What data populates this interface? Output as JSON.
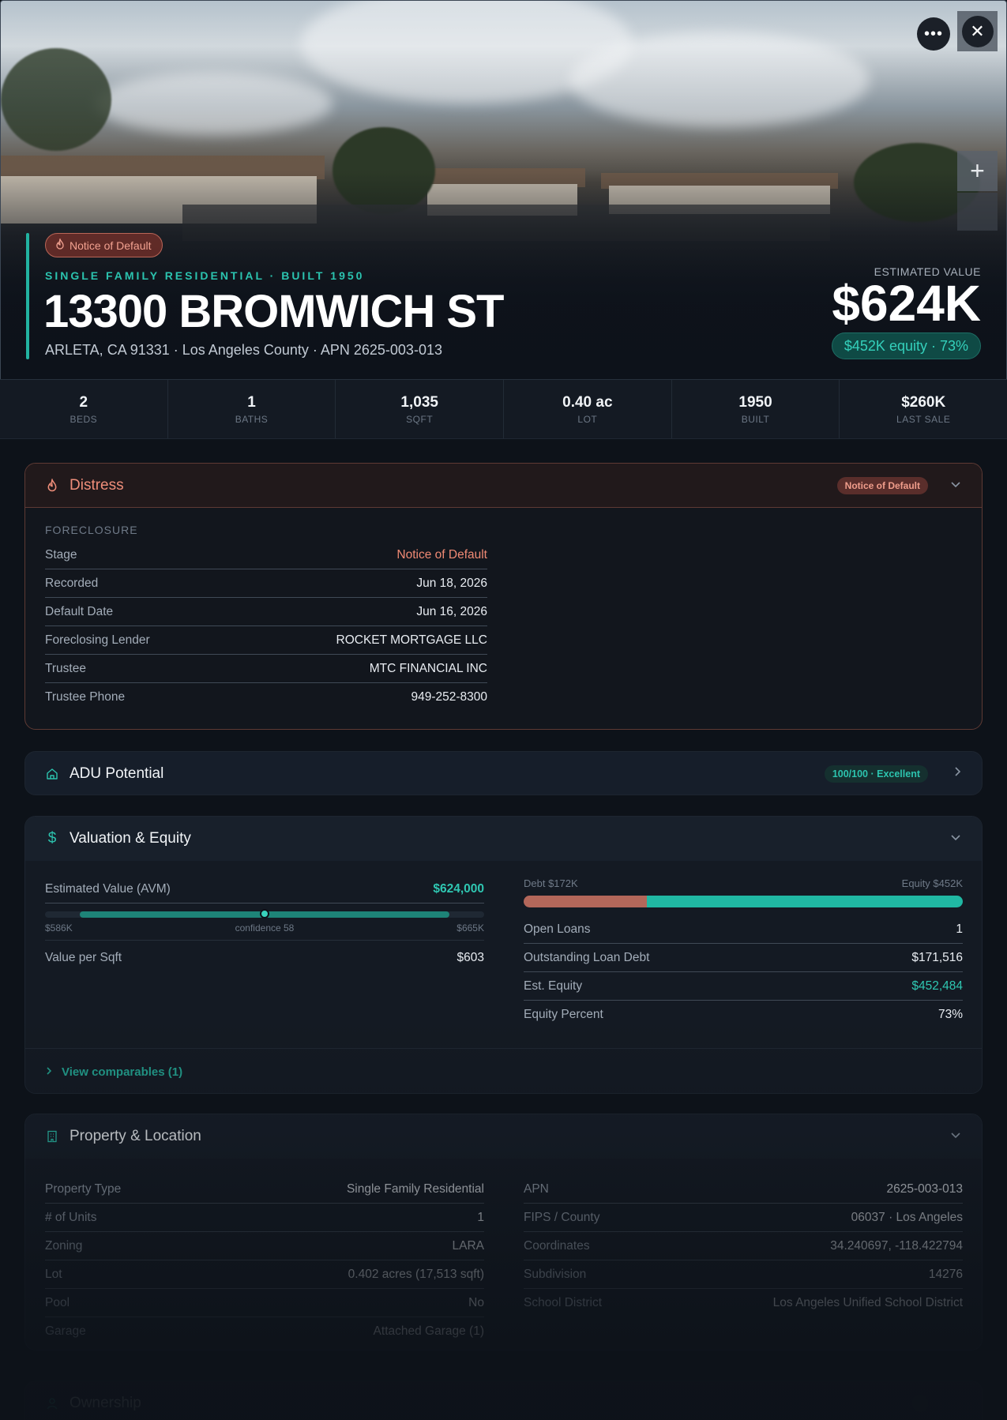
{
  "hero": {
    "distress_badge": "Notice of Default",
    "subtitle": "SINGLE FAMILY RESIDENTIAL · BUILT 1950",
    "title": "13300 BROMWICH ST",
    "address": "ARLETA, CA 91331 · Los Angeles County · APN 2625-003-013",
    "estimated_label": "ESTIMATED VALUE",
    "estimated_value": "$624K",
    "equity_pill": "$452K equity · 73%"
  },
  "stats": [
    {
      "value": "2",
      "label": "BEDS"
    },
    {
      "value": "1",
      "label": "BATHS"
    },
    {
      "value": "1,035",
      "label": "SQFT"
    },
    {
      "value": "0.40 ac",
      "label": "LOT"
    },
    {
      "value": "1950",
      "label": "BUILT"
    },
    {
      "value": "$260K",
      "label": "LAST SALE"
    }
  ],
  "distress": {
    "title": "Distress",
    "badge": "Notice of Default",
    "section": "FORECLOSURE",
    "rows": [
      {
        "k": "Stage",
        "v": "Notice of Default"
      },
      {
        "k": "Recorded",
        "v": "Jun 18, 2026"
      },
      {
        "k": "Default Date",
        "v": "Jun 16, 2026"
      },
      {
        "k": "Foreclosing Lender",
        "v": "ROCKET MORTGAGE LLC"
      },
      {
        "k": "Trustee",
        "v": "MTC FINANCIAL INC"
      },
      {
        "k": "Trustee Phone",
        "v": "949-252-8300"
      }
    ]
  },
  "adu": {
    "title": "ADU Potential",
    "badge": "100/100 · Excellent"
  },
  "valuation": {
    "title": "Valuation & Equity",
    "avm_label": "Estimated Value (AVM)",
    "avm_value": "$624,000",
    "range_low": "$586K",
    "range_high": "$665K",
    "confidence": "confidence 58",
    "avm_position": 0.5,
    "value_per_sqft_label": "Value per Sqft",
    "value_per_sqft": "$603",
    "debt_label": "Debt $172K",
    "equity_label": "Equity $452K",
    "debt_fraction": 0.28,
    "rows": [
      {
        "k": "Open Loans",
        "v": "1"
      },
      {
        "k": "Outstanding Loan Debt",
        "v": "$171,516"
      },
      {
        "k": "Est. Equity",
        "v": "$452,484"
      },
      {
        "k": "Equity Percent",
        "v": "73%"
      }
    ],
    "comparables": "View comparables (1)"
  },
  "property": {
    "title": "Property & Location",
    "left": [
      {
        "k": "Property Type",
        "v": "Single Family Residential"
      },
      {
        "k": "# of Units",
        "v": "1"
      },
      {
        "k": "Zoning",
        "v": "LARA"
      },
      {
        "k": "Lot",
        "v": "0.402 acres (17,513 sqft)"
      },
      {
        "k": "Pool",
        "v": "No"
      },
      {
        "k": "Garage",
        "v": "Attached Garage (1)"
      }
    ],
    "right": [
      {
        "k": "APN",
        "v": "2625-003-013"
      },
      {
        "k": "FIPS / County",
        "v": "06037 · Los Angeles"
      },
      {
        "k": "Coordinates",
        "v": "34.240697, -118.422794"
      },
      {
        "k": "Subdivision",
        "v": "14276"
      },
      {
        "k": "School District",
        "v": "Los Angeles Unified School District"
      }
    ]
  },
  "ownership": {
    "title": "Ownership"
  }
}
